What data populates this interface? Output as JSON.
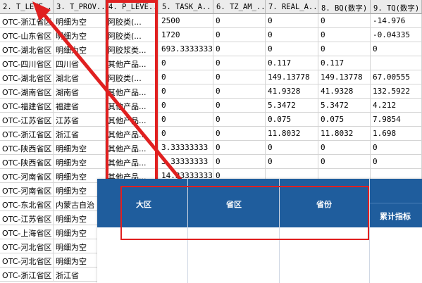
{
  "columns": [
    {
      "label": "2. T_LEVE...",
      "w": 76
    },
    {
      "label": "3. T_PROV...",
      "w": 74
    },
    {
      "label": "4. P_LEVE...",
      "w": 76
    },
    {
      "label": "5. TASK_A...",
      "w": 77
    },
    {
      "label": "6. TZ_AM_...",
      "w": 74
    },
    {
      "label": "7. REAL_A...",
      "w": 75
    },
    {
      "label": "8. BQ(数字)",
      "w": 74
    },
    {
      "label": "9. TQ(数字)",
      "w": 73
    }
  ],
  "rows": [
    [
      "OTC-浙江省区",
      "明细为空",
      "阿胶类(...",
      "2500",
      "0",
      "0",
      "0",
      "-14.976"
    ],
    [
      "OTC-山东省区",
      "明细为空",
      "阿胶类(...",
      "1720",
      "0",
      "0",
      "0",
      "-0.04335"
    ],
    [
      "OTC-湖北省区",
      "明细为空",
      "阿胶浆类...",
      "693.33333333",
      "0",
      "0",
      "0",
      "0"
    ],
    [
      "OTC-四川省区",
      "四川省",
      "其他产品...",
      "0",
      "0",
      "0.117",
      "0.117",
      ""
    ],
    [
      "OTC-湖北省区",
      "湖北省",
      "阿胶类(...",
      "0",
      "0",
      "149.13778",
      "149.13778",
      "67.00555"
    ],
    [
      "OTC-湖南省区",
      "湖南省",
      "其他产品...",
      "0",
      "0",
      "41.9328",
      "41.9328",
      "132.5922"
    ],
    [
      "OTC-福建省区",
      "福建省",
      "其他产品...",
      "0",
      "0",
      "5.3472",
      "5.3472",
      "4.212"
    ],
    [
      "OTC-江苏省区",
      "江苏省",
      "其他产品...",
      "0",
      "0",
      "0.075",
      "0.075",
      "7.9854"
    ],
    [
      "OTC-浙江省区",
      "浙江省",
      "其他产品...",
      "0",
      "0",
      "11.8032",
      "11.8032",
      "1.698"
    ],
    [
      "OTC-陕西省区",
      "明细为空",
      "其他产品...",
      "3.33333333",
      "0",
      "0",
      "0",
      "0"
    ],
    [
      "OTC-陕西省区",
      "明细为空",
      "其他产品...",
      "3.33333333",
      "0",
      "0",
      "0",
      "0"
    ],
    [
      "OTC-河南省区",
      "明细为空",
      "其他产品...",
      "14.33333333",
      "0",
      "",
      "",
      ""
    ],
    [
      "OTC-河南省区",
      "明细为空",
      "",
      "",
      "",
      "",
      "",
      ""
    ],
    [
      "OTC-东北省区",
      "内蒙古自治",
      "",
      "",
      "",
      "",
      "",
      ""
    ],
    [
      "OTC-江苏省区",
      "明细为空",
      "",
      "",
      "",
      "",
      "",
      ""
    ],
    [
      "OTC-上海省区",
      "明细为空",
      "",
      "",
      "",
      "",
      "",
      ""
    ],
    [
      "OTC-河北省区",
      "明细为空",
      "",
      "",
      "",
      "",
      "",
      ""
    ],
    [
      "OTC-河北省区",
      "明细为空",
      "",
      "",
      "",
      "",
      "",
      ""
    ],
    [
      "OTC-浙江省区",
      "浙江省",
      "",
      "",
      "",
      "",
      "",
      ""
    ]
  ],
  "overlay": {
    "headers": [
      "大区",
      "省区",
      "省份"
    ],
    "extra_header": "累计指标"
  },
  "colors": {
    "header_blue": "#1f5d9d",
    "annotation_red": "#e02020"
  }
}
